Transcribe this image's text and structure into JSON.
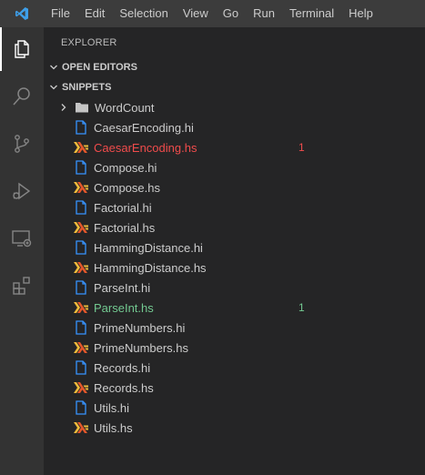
{
  "menu": [
    "File",
    "Edit",
    "Selection",
    "View",
    "Go",
    "Run",
    "Terminal",
    "Help"
  ],
  "explorer": {
    "title": "EXPLORER",
    "sections": {
      "open_editors": "OPEN EDITORS",
      "snippets": "SNIPPETS"
    },
    "folder": {
      "name": "WordCount",
      "expanded": false
    },
    "files": [
      {
        "name": "CaesarEncoding.hi",
        "type": "hi",
        "badge": "",
        "status": ""
      },
      {
        "name": "CaesarEncoding.hs",
        "type": "hs",
        "badge": "1",
        "status": "error"
      },
      {
        "name": "Compose.hi",
        "type": "hi",
        "badge": "",
        "status": ""
      },
      {
        "name": "Compose.hs",
        "type": "hs",
        "badge": "",
        "status": ""
      },
      {
        "name": "Factorial.hi",
        "type": "hi",
        "badge": "",
        "status": ""
      },
      {
        "name": "Factorial.hs",
        "type": "hs",
        "badge": "",
        "status": ""
      },
      {
        "name": "HammingDistance.hi",
        "type": "hi",
        "badge": "",
        "status": ""
      },
      {
        "name": "HammingDistance.hs",
        "type": "hs",
        "badge": "",
        "status": ""
      },
      {
        "name": "ParseInt.hi",
        "type": "hi",
        "badge": "",
        "status": ""
      },
      {
        "name": "ParseInt.hs",
        "type": "hs",
        "badge": "1",
        "status": "modified"
      },
      {
        "name": "PrimeNumbers.hi",
        "type": "hi",
        "badge": "",
        "status": ""
      },
      {
        "name": "PrimeNumbers.hs",
        "type": "hs",
        "badge": "",
        "status": ""
      },
      {
        "name": "Records.hi",
        "type": "hi",
        "badge": "",
        "status": ""
      },
      {
        "name": "Records.hs",
        "type": "hs",
        "badge": "",
        "status": ""
      },
      {
        "name": "Utils.hi",
        "type": "hi",
        "badge": "",
        "status": ""
      },
      {
        "name": "Utils.hs",
        "type": "hs",
        "badge": "",
        "status": ""
      }
    ]
  },
  "colors": {
    "accent": "#0078d4",
    "error": "#f14c4c",
    "modified": "#73c991",
    "hi_icon": "#3794ff",
    "hs_icon_1": "#f0bb3b",
    "hs_icon_2": "#e3572b"
  }
}
